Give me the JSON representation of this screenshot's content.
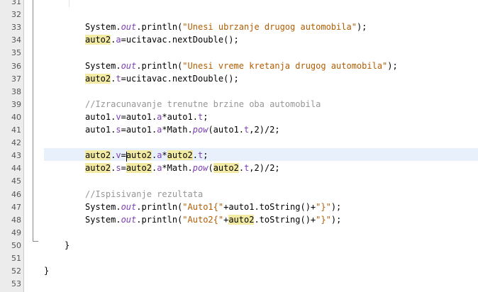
{
  "line_numbers": [
    "31",
    "32",
    "33",
    "34",
    "35",
    "36",
    "37",
    "38",
    "39",
    "40",
    "41",
    "42",
    "43",
    "44",
    "45",
    "46",
    "47",
    "48",
    "49",
    "50",
    "51",
    "52",
    "53"
  ],
  "lines": [
    {
      "n": 31,
      "tokens": []
    },
    {
      "n": 32,
      "tokens": []
    },
    {
      "n": 33,
      "indent": 8,
      "tokens": [
        {
          "t": "System."
        },
        {
          "t": "out",
          "c": "stat"
        },
        {
          "t": ".println("
        },
        {
          "t": "\"Unesi ubrzanje drugog automobila\"",
          "c": "str"
        },
        {
          "t": ");"
        }
      ]
    },
    {
      "n": 34,
      "indent": 8,
      "tokens": [
        {
          "t": "auto2",
          "c": "hl"
        },
        {
          "t": "."
        },
        {
          "t": "a",
          "c": "fld"
        },
        {
          "t": "=ucitavac.nextDouble();"
        }
      ]
    },
    {
      "n": 35,
      "tokens": []
    },
    {
      "n": 36,
      "indent": 8,
      "tokens": [
        {
          "t": "System."
        },
        {
          "t": "out",
          "c": "stat"
        },
        {
          "t": ".println("
        },
        {
          "t": "\"Unesi vreme kretanja drugog automobila\"",
          "c": "str"
        },
        {
          "t": ");"
        }
      ]
    },
    {
      "n": 37,
      "indent": 8,
      "tokens": [
        {
          "t": "auto2",
          "c": "hl"
        },
        {
          "t": "."
        },
        {
          "t": "t",
          "c": "fld"
        },
        {
          "t": "=ucitavac.nextDouble();"
        }
      ]
    },
    {
      "n": 38,
      "tokens": []
    },
    {
      "n": 39,
      "indent": 8,
      "tokens": [
        {
          "t": "//Izracunavanje trenutne brzine oba automobila",
          "c": "cmt"
        }
      ]
    },
    {
      "n": 40,
      "indent": 8,
      "tokens": [
        {
          "t": "auto1."
        },
        {
          "t": "v",
          "c": "fld"
        },
        {
          "t": "=auto1."
        },
        {
          "t": "a",
          "c": "fld"
        },
        {
          "t": "*auto1."
        },
        {
          "t": "t",
          "c": "fld"
        },
        {
          "t": ";"
        }
      ]
    },
    {
      "n": 41,
      "indent": 8,
      "tokens": [
        {
          "t": "auto1."
        },
        {
          "t": "s",
          "c": "fld"
        },
        {
          "t": "=auto1."
        },
        {
          "t": "a",
          "c": "fld"
        },
        {
          "t": "*Math."
        },
        {
          "t": "pow",
          "c": "stat"
        },
        {
          "t": "(auto1."
        },
        {
          "t": "t",
          "c": "fld"
        },
        {
          "t": ",2)/2;"
        }
      ]
    },
    {
      "n": 42,
      "tokens": []
    },
    {
      "n": 43,
      "indent": 8,
      "current": true,
      "tokens": [
        {
          "t": "auto2",
          "c": "hl"
        },
        {
          "t": "."
        },
        {
          "t": "v",
          "c": "fld"
        },
        {
          "t": "="
        },
        {
          "t": "auto2",
          "c": "hl"
        },
        {
          "t": "."
        },
        {
          "t": "a",
          "c": "fld"
        },
        {
          "t": "*"
        },
        {
          "t": "auto2",
          "c": "hl"
        },
        {
          "t": "."
        },
        {
          "t": "t",
          "c": "fld"
        },
        {
          "t": ";"
        }
      ]
    },
    {
      "n": 44,
      "indent": 8,
      "tokens": [
        {
          "t": "auto2",
          "c": "hl"
        },
        {
          "t": "."
        },
        {
          "t": "s",
          "c": "fld"
        },
        {
          "t": "="
        },
        {
          "t": "auto2",
          "c": "hl"
        },
        {
          "t": "."
        },
        {
          "t": "a",
          "c": "fld"
        },
        {
          "t": "*Math."
        },
        {
          "t": "pow",
          "c": "stat"
        },
        {
          "t": "("
        },
        {
          "t": "auto2",
          "c": "hl"
        },
        {
          "t": "."
        },
        {
          "t": "t",
          "c": "fld"
        },
        {
          "t": ",2)/2;"
        }
      ]
    },
    {
      "n": 45,
      "tokens": []
    },
    {
      "n": 46,
      "indent": 8,
      "tokens": [
        {
          "t": "//Ispisivanje rezultata",
          "c": "cmt"
        }
      ]
    },
    {
      "n": 47,
      "indent": 8,
      "tokens": [
        {
          "t": "System."
        },
        {
          "t": "out",
          "c": "stat"
        },
        {
          "t": ".println("
        },
        {
          "t": "\"Auto1{\"",
          "c": "str"
        },
        {
          "t": "+auto1.toString()+"
        },
        {
          "t": "\"}\"",
          "c": "str"
        },
        {
          "t": ");"
        }
      ]
    },
    {
      "n": 48,
      "indent": 8,
      "tokens": [
        {
          "t": "System."
        },
        {
          "t": "out",
          "c": "stat"
        },
        {
          "t": ".println("
        },
        {
          "t": "\"Auto2{\"",
          "c": "str"
        },
        {
          "t": "+"
        },
        {
          "t": "auto2",
          "c": "hl"
        },
        {
          "t": ".toString()+"
        },
        {
          "t": "\"}\"",
          "c": "str"
        },
        {
          "t": ");"
        }
      ]
    },
    {
      "n": 49,
      "tokens": []
    },
    {
      "n": 50,
      "indent": 4,
      "tokens": [
        {
          "t": "}"
        }
      ]
    },
    {
      "n": 51,
      "tokens": []
    },
    {
      "n": 52,
      "indent": 0,
      "tokens": [
        {
          "t": "}"
        }
      ]
    },
    {
      "n": 53,
      "tokens": []
    }
  ],
  "colors": {
    "current_line": "#e8f0fb",
    "occurrence_highlight": "#f3eba4",
    "string": "#b35c00",
    "field": "#7b40b5",
    "comment": "#969696"
  }
}
